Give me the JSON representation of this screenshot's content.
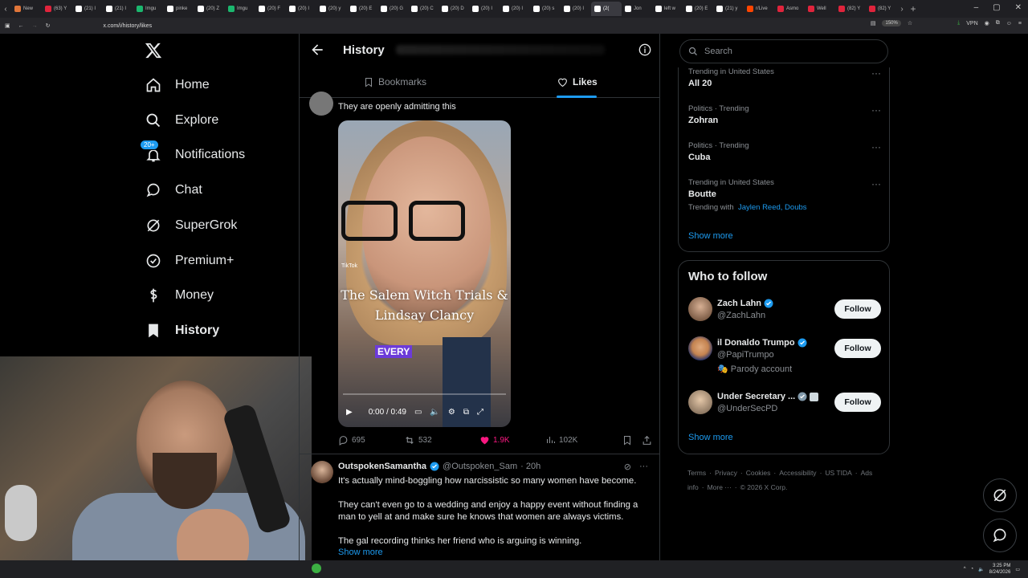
{
  "browser": {
    "tabs": [
      {
        "label": "New",
        "color": "#e0763a"
      },
      {
        "label": "(63) Y",
        "color": "#e0243c"
      },
      {
        "label": "(21) I",
        "color": "#ffffff"
      },
      {
        "label": "(21) I",
        "color": "#ffffff"
      },
      {
        "label": "Imgu",
        "color": "#1bb76e"
      },
      {
        "label": "pinke",
        "color": "#ffffff"
      },
      {
        "label": "(20) Z",
        "color": "#ffffff"
      },
      {
        "label": "Imgu",
        "color": "#1bb76e"
      },
      {
        "label": "(20) F",
        "color": "#ffffff"
      },
      {
        "label": "(20) I",
        "color": "#ffffff"
      },
      {
        "label": "(20) y",
        "color": "#ffffff"
      },
      {
        "label": "(20) E",
        "color": "#ffffff"
      },
      {
        "label": "(20) G",
        "color": "#ffffff"
      },
      {
        "label": "(20) C",
        "color": "#ffffff"
      },
      {
        "label": "(20) D",
        "color": "#ffffff"
      },
      {
        "label": "(20) I",
        "color": "#ffffff"
      },
      {
        "label": "(20) I",
        "color": "#ffffff"
      },
      {
        "label": "(20) s",
        "color": "#ffffff"
      },
      {
        "label": "(20) I",
        "color": "#ffffff"
      },
      {
        "label": "(2(",
        "color": "#ffffff",
        "active": true
      },
      {
        "label": "Jon",
        "color": "#ffffff"
      },
      {
        "label": "left w",
        "color": "#ffffff"
      },
      {
        "label": "(20) E",
        "color": "#ffffff"
      },
      {
        "label": "(21) y",
        "color": "#ffffff"
      },
      {
        "label": "r/Live",
        "color": "#ff4500"
      },
      {
        "label": "Asmo",
        "color": "#e0243c"
      },
      {
        "label": "Well",
        "color": "#e0243c"
      },
      {
        "label": "(82) Y",
        "color": "#e0243c"
      },
      {
        "label": "(82) Y",
        "color": "#e0243c"
      }
    ],
    "url": "x.com/i/history/likes",
    "zoom": "150%",
    "vpn": "VPN"
  },
  "nav": {
    "items": [
      {
        "label": "Home",
        "icon": "home-icon"
      },
      {
        "label": "Explore",
        "icon": "search-icon"
      },
      {
        "label": "Notifications",
        "icon": "bell-icon",
        "badge": "20+"
      },
      {
        "label": "Chat",
        "icon": "chat-icon"
      },
      {
        "label": "SuperGrok",
        "icon": "grok-icon"
      },
      {
        "label": "Premium+",
        "icon": "premium-icon"
      },
      {
        "label": "Money",
        "icon": "money-icon"
      },
      {
        "label": "History",
        "icon": "history-icon",
        "active": true
      }
    ]
  },
  "main": {
    "title": "History",
    "tabs": [
      {
        "label": "Bookmarks",
        "icon": "bookmark-icon"
      },
      {
        "label": "Likes",
        "icon": "heart-icon",
        "active": true
      }
    ],
    "tweet1": {
      "text": "They are openly admitting this",
      "video": {
        "overlay_line1": "The Salem Witch Trials &",
        "overlay_line2": "Lindsay Clancy",
        "caption": "EVERY",
        "watermark": "TikTok",
        "time": "0:00 / 0:49"
      },
      "replies": "695",
      "reposts": "532",
      "likes": "1.9K",
      "views": "102K",
      "like_color": "#f91880"
    },
    "tweet2": {
      "name": "OutspokenSamantha",
      "handle": "@Outspoken_Sam",
      "time": "· 20h",
      "p1": "It's actually mind-boggling how narcissistic so many women have become.",
      "p2": "They can't even go to a wedding and enjoy a happy event without finding a man to yell at and make sure he knows that women are always victims.",
      "p3": "The gal recording thinks her friend who is arguing is winning.",
      "show_more": "Show more"
    }
  },
  "sidebar": {
    "search_placeholder": "Search",
    "trends": [
      {
        "meta": "Trending in United States",
        "name": "All 20"
      },
      {
        "meta": "Politics · Trending",
        "name": "Zohran"
      },
      {
        "meta": "Politics · Trending",
        "name": "Cuba"
      },
      {
        "meta": "Trending in United States",
        "name": "Boutte",
        "with_label": "Trending with",
        "with_links": "Jaylen Reed, Doubs"
      }
    ],
    "trends_show_more": "Show more",
    "who_to_follow": {
      "title": "Who to follow",
      "users": [
        {
          "name": "Zach Lahn",
          "handle": "@ZachLahn",
          "button": "Follow"
        },
        {
          "name": "il Donaldo Trumpo",
          "handle": "@PapiTrumpo",
          "extra": "Parody account",
          "button": "Follow"
        },
        {
          "name": "Under Secretary ...",
          "handle": "@UnderSecPD",
          "button": "Follow"
        }
      ],
      "show_more": "Show more"
    },
    "footer": [
      "Terms",
      "·",
      "Privacy",
      "·",
      "Cookies",
      "·",
      "Accessibility",
      "·",
      "US TIDA",
      "·",
      "Ads info",
      "·",
      "More ···",
      "·",
      "© 2026 X Corp."
    ]
  },
  "taskbar": {
    "time": "3:25 PM",
    "date": "8/24/2026"
  },
  "colors": {
    "accent": "#1d9bf0",
    "background": "#000000",
    "border": "#2f3336"
  }
}
